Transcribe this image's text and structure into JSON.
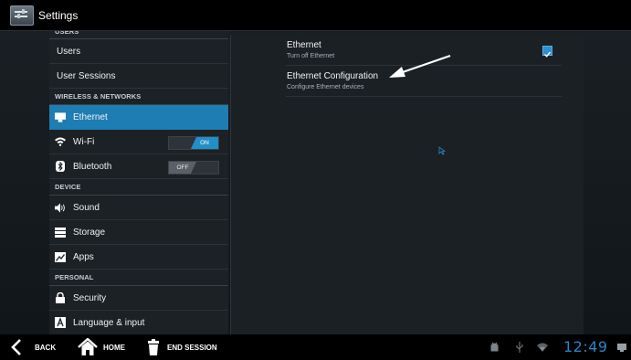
{
  "window": {
    "title": "Settings"
  },
  "left": {
    "users_header": "USERS",
    "users": "Users",
    "user_sessions": "User Sessions",
    "wireless_header": "WIRELESS & NETWORKS",
    "ethernet": "Ethernet",
    "wifi": "Wi-Fi",
    "wifi_toggle": "ON",
    "bluetooth": "Bluetooth",
    "bluetooth_toggle": "OFF",
    "device_header": "DEVICE",
    "sound": "Sound",
    "storage": "Storage",
    "apps": "Apps",
    "personal_header": "PERSONAL",
    "security": "Security",
    "language": "Language & input"
  },
  "right": {
    "ethernet_title": "Ethernet",
    "ethernet_summary": "Turn off Ethernet",
    "ethernet_checked": true,
    "config_title": "Ethernet Configuration",
    "config_summary": "Configure Ethernet devices"
  },
  "navbar": {
    "back": "BACK",
    "home": "HOME",
    "end_session": "END SESSION",
    "clock": "12:49"
  },
  "colors": {
    "accent": "#1e7db3",
    "clock": "#2a86c6"
  }
}
